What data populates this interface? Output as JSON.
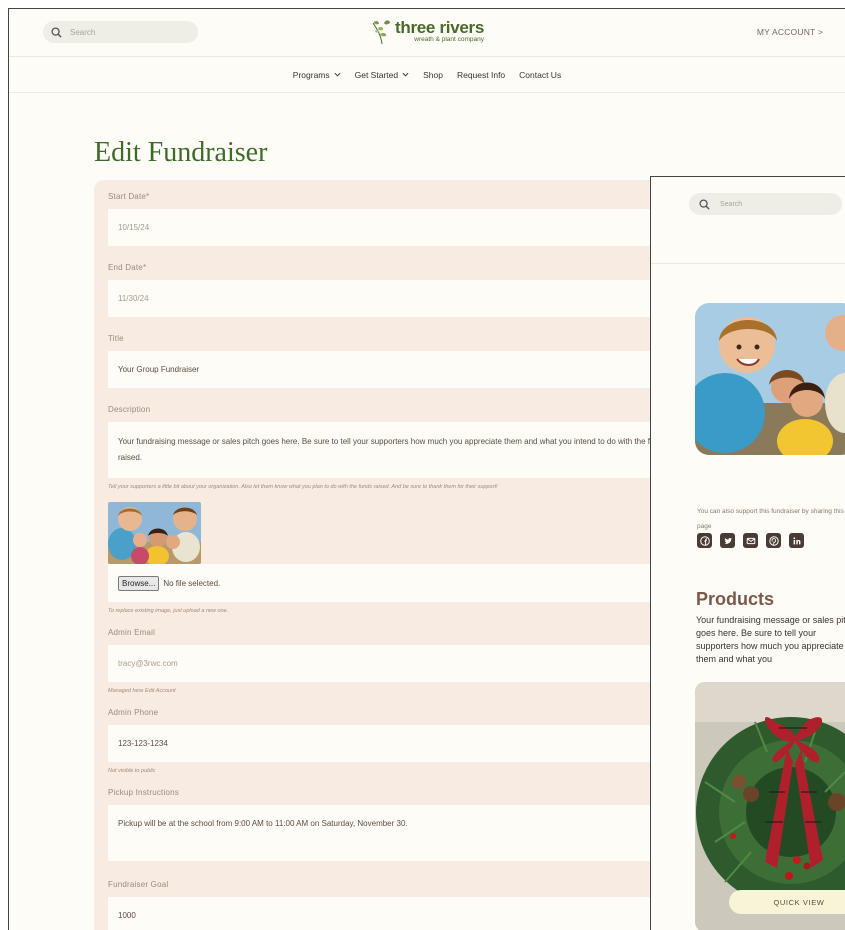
{
  "header": {
    "search_placeholder": "Search",
    "logo_main": "three rivers",
    "logo_sub": "wreath & plant company",
    "account_link": "MY ACCOUNT >"
  },
  "nav": {
    "items": [
      {
        "label": "Programs",
        "has_dropdown": true
      },
      {
        "label": "Get Started",
        "has_dropdown": true
      },
      {
        "label": "Shop",
        "has_dropdown": false
      },
      {
        "label": "Request Info",
        "has_dropdown": false
      },
      {
        "label": "Contact Us",
        "has_dropdown": false
      }
    ]
  },
  "page_title": "Edit Fundraiser",
  "form": {
    "start_date_label": "Start Date*",
    "start_date_value": "10/15/24",
    "end_date_label": "End Date*",
    "end_date_value": "11/30/24",
    "title_label": "Title",
    "title_value": "Your Group Fundraiser",
    "description_label": "Description",
    "description_value": "Your fundraising message or sales pitch goes here. Be sure to tell your supporters how much you appreciate them and what you intend to do with the funds raised.",
    "description_help": "Tell your supporters a little bit about your organization. Also let them know what you plan to do with the funds raised. And be sure to thank them for their support!",
    "browse_button": "Browse...",
    "file_status": "No file selected.",
    "image_help": "To replace existing image, just upload a new one.",
    "admin_email_label": "Admin Email",
    "admin_email_value": "tracy@3rwc.com",
    "admin_email_help": "Managed here Edit Account",
    "admin_phone_label": "Admin Phone",
    "admin_phone_value": "123-123-1234",
    "admin_phone_help": "Not visible to public",
    "pickup_label": "Pickup Instructions",
    "pickup_value": "Pickup will be at the school from 9:00 AM to 11:00 AM on Saturday, November 30.",
    "goal_label": "Fundraiser Goal",
    "goal_value": "1000"
  },
  "preview": {
    "search_placeholder": "Search",
    "support_text": "You can also support this fundraiser by sharing this page",
    "social_icons": [
      "facebook-icon",
      "twitter-icon",
      "email-icon",
      "pinterest-icon",
      "linkedin-icon"
    ],
    "products_heading": "Products",
    "products_desc": "Your fundraising message or sales pitch goes here. Be sure to tell your supporters how much you appreciate them and what you",
    "quick_view": "QUICK VIEW"
  },
  "colors": {
    "brand_green": "#3f6b2a",
    "form_bg": "#f8ece2",
    "products_brown": "#7b5a4b"
  }
}
